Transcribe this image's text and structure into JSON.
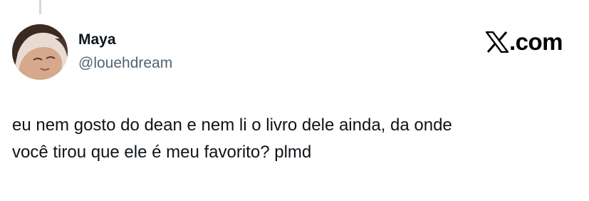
{
  "tweet": {
    "author": {
      "display_name": "Maya",
      "handle": "@louehdream",
      "avatar_icon": "profile-photo"
    },
    "brand": {
      "icon": "x-logo-icon",
      "suffix": ".com"
    },
    "text_lines": [
      "eu nem gosto do dean e nem li o livro dele ainda, da onde",
      "você tirou que ele é meu favorito? plmd"
    ]
  },
  "colors": {
    "text_primary": "#0f1419",
    "text_secondary": "#536471",
    "thread_line": "#cfd9de",
    "background": "#ffffff"
  }
}
